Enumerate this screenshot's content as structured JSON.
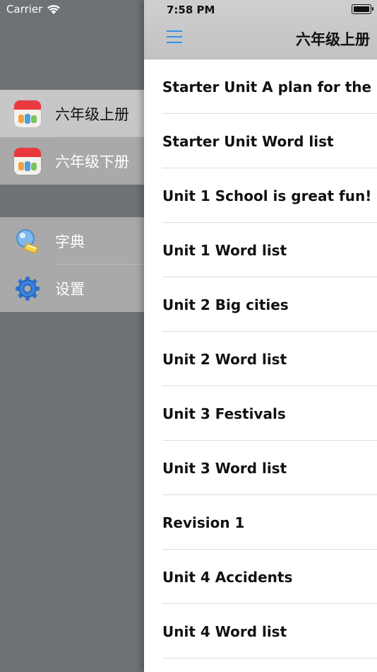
{
  "status_bar": {
    "carrier": "Carrier",
    "time": "7:58 PM"
  },
  "drawer": {
    "books": [
      {
        "label": "六年级上册",
        "icon": "book-cover-icon",
        "selected": true
      },
      {
        "label": "六年级下册",
        "icon": "book-cover-icon",
        "selected": false
      }
    ],
    "tools": [
      {
        "label": "字典",
        "icon": "dictionary-icon"
      },
      {
        "label": "设置",
        "icon": "gear-icon"
      }
    ]
  },
  "navbar": {
    "title": "六年级上册",
    "menu_icon": "hamburger-menu-icon"
  },
  "lessons": [
    "Starter Unit A plan for the new",
    "Starter Unit Word list",
    "Unit 1 School is great fun!",
    "Unit 1 Word list",
    "Unit 2 Big cities",
    "Unit 2 Word list",
    "Unit 3 Festivals",
    "Unit 3 Word list",
    "Revision 1",
    "Unit 4 Accidents",
    "Unit 4 Word list"
  ],
  "colors": {
    "accent": "#3a8ee6",
    "drawer_bg": "#6e7175",
    "drawer_group": "#a9a9aa",
    "selected": "#c7c7c8"
  }
}
